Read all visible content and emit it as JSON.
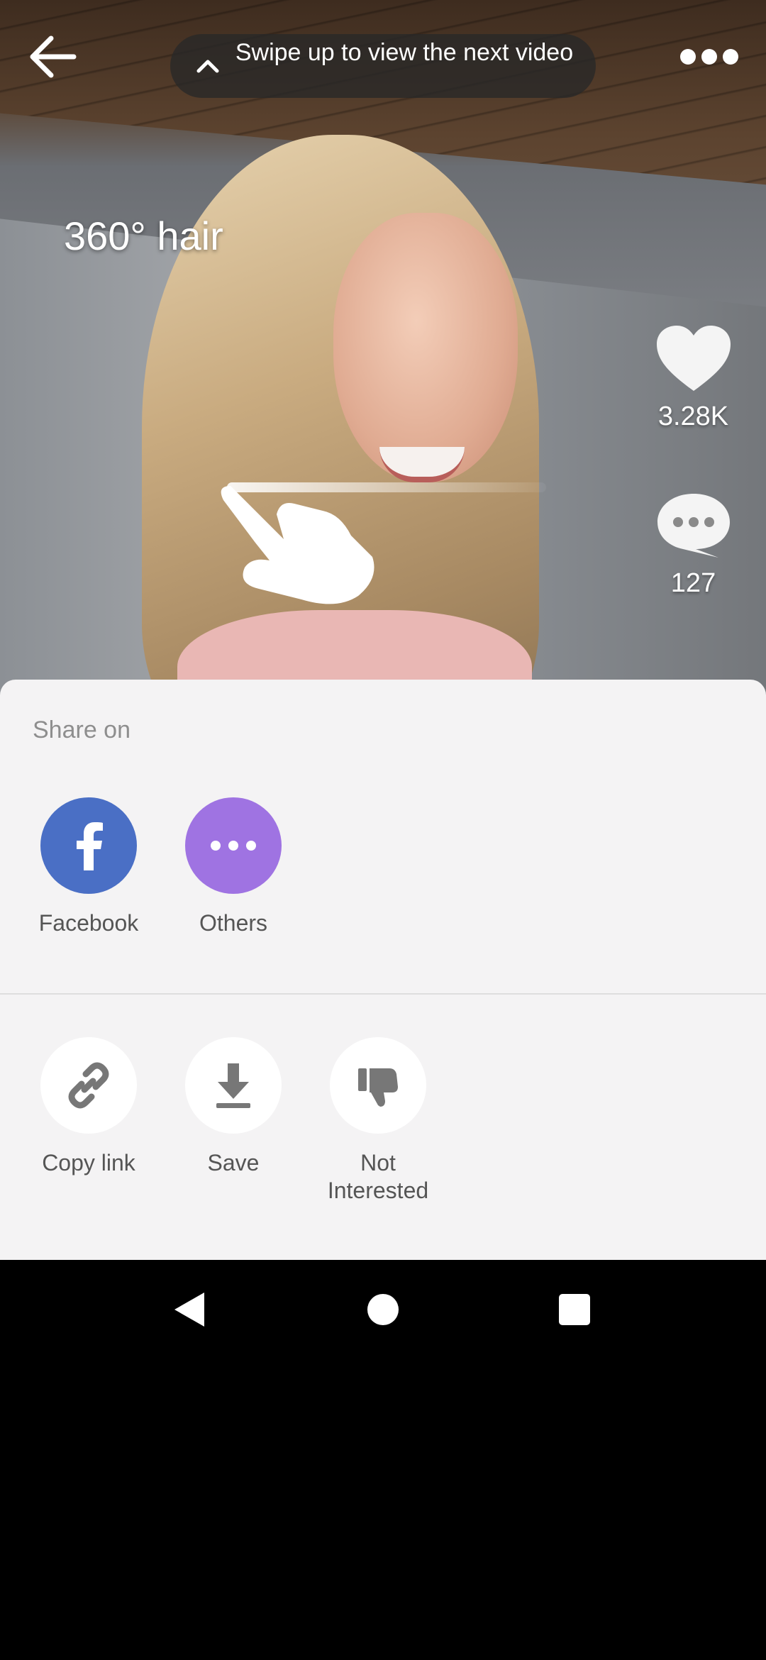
{
  "video": {
    "caption": "360° hair",
    "swipe_hint": "Swipe up to view the next video"
  },
  "actions": {
    "likes": "3.28K",
    "comments": "127"
  },
  "share_sheet": {
    "title": "Share on",
    "targets": [
      {
        "label": "Facebook",
        "icon": "facebook-icon",
        "color": "#4a6fc5"
      },
      {
        "label": "Others",
        "icon": "more-icon",
        "color": "#9f73e2"
      }
    ],
    "tools": [
      {
        "label": "Copy link",
        "icon": "link-icon"
      },
      {
        "label": "Save",
        "icon": "download-icon"
      },
      {
        "label": "Not Interested",
        "icon": "thumbs-down-icon"
      }
    ]
  },
  "colors": {
    "sheet_background": "#f4f3f4",
    "facebook_blue": "#4a6fc5",
    "others_purple": "#9f73e2",
    "icon_gray": "#777777"
  }
}
